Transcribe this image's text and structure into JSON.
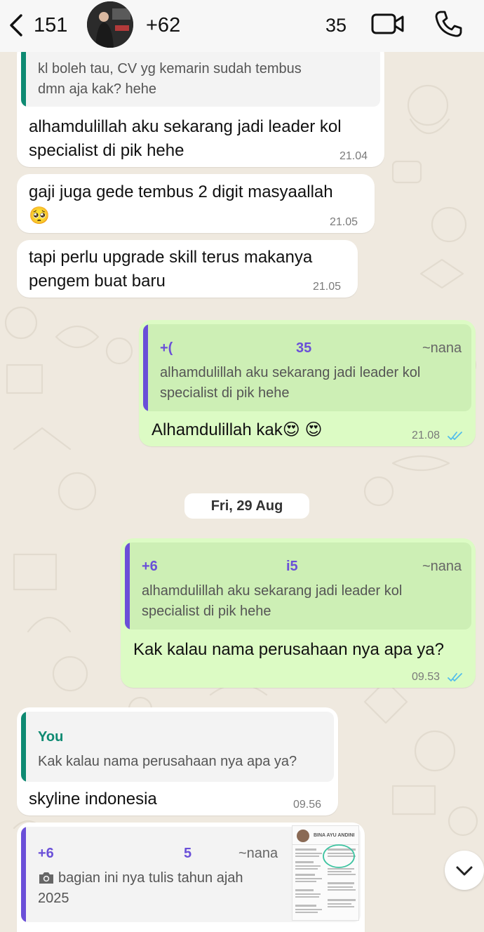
{
  "header": {
    "unread_count": "151",
    "contact_name": "+62",
    "contact_name_tail": "35"
  },
  "messages": [
    {
      "direction": "incoming",
      "quote_text_1": "kl boleh tau, CV yg kemarin sudah tembus",
      "quote_text_2": "dmn aja kak? hehe",
      "text_1": "alhamdulillah aku sekarang jadi leader kol",
      "text_2": "specialist di pik hehe",
      "time": "21.04"
    },
    {
      "direction": "incoming",
      "text_1": "gaji juga gede tembus 2 digit masyaallah",
      "text_2": "🥺",
      "time": "21.05"
    },
    {
      "direction": "incoming",
      "text_1": "tapi perlu upgrade skill terus makanya",
      "text_2": "pengem buat baru",
      "time": "21.05"
    },
    {
      "direction": "outgoing",
      "quote_sender": "+(",
      "quote_sender_tail": "35",
      "quote_alias": "~nana",
      "quote_text_1": "alhamdulillah aku sekarang jadi leader kol",
      "quote_text_2": "specialist di pik hehe",
      "text_1": "Alhamdulillah kak😍 😍",
      "time": "21.08"
    },
    {
      "direction": "outgoing",
      "quote_sender": "+6",
      "quote_sender_tail": "i5",
      "quote_alias": "~nana",
      "quote_text_1": "alhamdulillah aku sekarang jadi leader kol",
      "quote_text_2": "specialist di pik hehe",
      "text_1": "Kak kalau nama perusahaan nya apa ya?",
      "time": "09.53"
    },
    {
      "direction": "incoming",
      "quote_sender": "You",
      "quote_text_1": "Kak kalau nama perusahaan nya apa ya?",
      "text_1": "skyline indonesia",
      "time": "09.56"
    },
    {
      "direction": "incoming",
      "quote_sender": "+6",
      "quote_sender_tail": "5",
      "quote_alias": "~nana",
      "quote_text_1": "bagian ini nya tulis tahun ajah",
      "quote_text_2": "2025"
    }
  ],
  "date_separator": "Fri, 29 Aug",
  "thumbnail": {
    "doc_name": "BINA AYU ANDINI"
  },
  "colors": {
    "chat_background": "#efe9df",
    "incoming_bubble": "#ffffff",
    "outgoing_bubble": "#dcfbc4",
    "outgoing_quote": "#cdefb5",
    "quote_bar_purple": "#6a4fd8",
    "quote_bar_teal": "#0e8a72",
    "read_ticks": "#53bdeb"
  },
  "icons": {
    "back": "chevron-left-icon",
    "video": "video-camera-icon",
    "call": "phone-icon",
    "photo": "camera-icon",
    "scroll": "chevron-down-icon",
    "read": "double-check-icon"
  }
}
